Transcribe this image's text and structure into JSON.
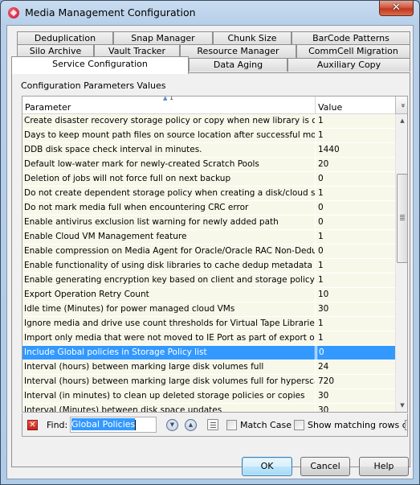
{
  "window": {
    "title": "Media Management Configuration",
    "close_glyph": "✕"
  },
  "tabs": {
    "row1": [
      "Deduplication",
      "Snap Manager",
      "Chunk Size",
      "BarCode Patterns"
    ],
    "row2": [
      "Silo Archive",
      "Vault Tracker",
      "Resource Manager",
      "CommCell Migration"
    ],
    "row3": [
      "Service Configuration",
      "Data Aging",
      "Auxiliary Copy"
    ],
    "active": "Service Configuration"
  },
  "panel": {
    "title": "Configuration Parameters Values"
  },
  "grid": {
    "columns": {
      "parameter": "Parameter",
      "value": "Value"
    },
    "sort_indicator": "1",
    "rows": [
      {
        "parameter": "Create disaster recovery storage policy or copy when new library is confi…",
        "value": "1"
      },
      {
        "parameter": "Days to keep mount path files on source location after successful move m…",
        "value": "1"
      },
      {
        "parameter": "DDB disk space check interval in minutes.",
        "value": "1440"
      },
      {
        "parameter": "Default low-water mark for newly-created Scratch Pools",
        "value": "20"
      },
      {
        "parameter": "Deletion of jobs will not force full on next backup",
        "value": "0"
      },
      {
        "parameter": "Do not create dependent storage policy when creating a disk/cloud  stora…",
        "value": "1"
      },
      {
        "parameter": "Do not mark media full when encountering CRC error",
        "value": "0"
      },
      {
        "parameter": "Enable antivirus exclusion list warning for newly added path",
        "value": "0"
      },
      {
        "parameter": "Enable Cloud VM Management feature",
        "value": "1"
      },
      {
        "parameter": "Enable compression on Media Agent for Oracle/Oracle RAC Non-Dedup b…",
        "value": "0"
      },
      {
        "parameter": "Enable functionality of using disk libraries to cache dedup metadata for cl…",
        "value": "1"
      },
      {
        "parameter": "Enable generating encryption key based on client and storage policy copy",
        "value": "1"
      },
      {
        "parameter": "Export Operation Retry Count",
        "value": "10"
      },
      {
        "parameter": "Idle time (Minutes) for power managed cloud VMs",
        "value": "30"
      },
      {
        "parameter": "Ignore media and drive use count thresholds for Virtual Tape Libraries",
        "value": "1"
      },
      {
        "parameter": "Import only  media that were not moved to IE Port as part of export oper…",
        "value": "1"
      },
      {
        "parameter": "Include Global policies in Storage Policy list",
        "value": "0",
        "selected": true
      },
      {
        "parameter": "Interval (hours) between marking large disk volumes full",
        "value": "24"
      },
      {
        "parameter": "Interval (hours) between marking large disk volumes full for hyperscale.",
        "value": "720"
      },
      {
        "parameter": "Interval (in minutes) to clean up deleted storage policies or copies",
        "value": "30"
      },
      {
        "parameter": "Interval (Minutes) between disk space updates",
        "value": "30"
      }
    ],
    "column_menu_glyph": "»"
  },
  "findbar": {
    "label": "Find:",
    "value": "Global Policies",
    "match_case_label": "Match Case",
    "match_case_checked": false,
    "show_matching_label": "Show matching rows only",
    "show_matching_checked": false
  },
  "buttons": {
    "ok": "OK",
    "cancel": "Cancel",
    "help": "Help"
  },
  "colors": {
    "selection": "#3399ff",
    "row_bg": "#f8f8ea"
  }
}
